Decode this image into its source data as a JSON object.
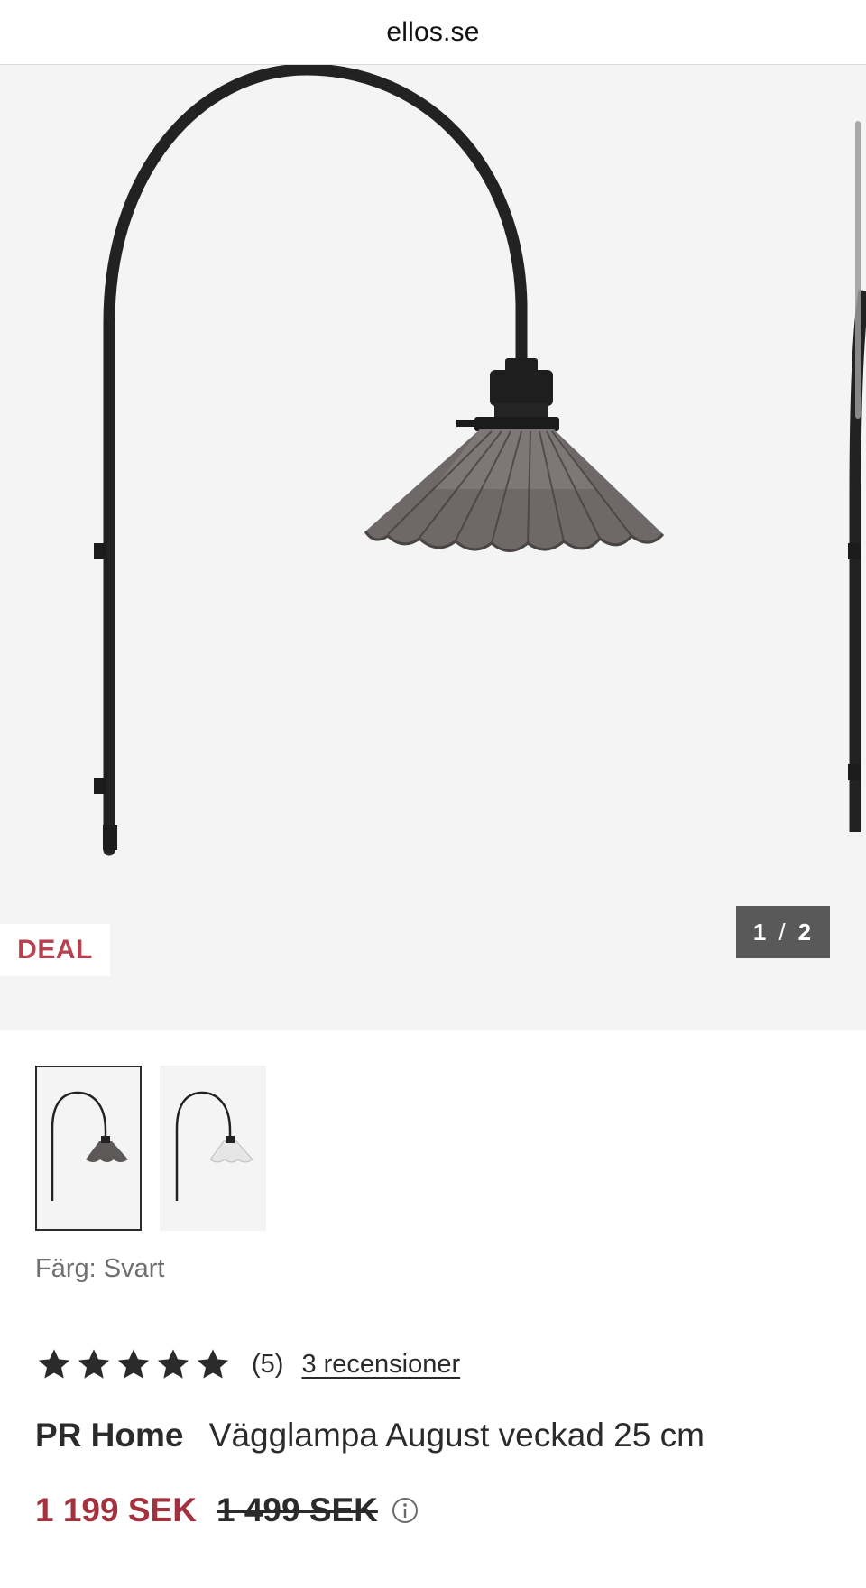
{
  "browser": {
    "domain": "ellos.se"
  },
  "gallery": {
    "badge": "DEAL",
    "counter": {
      "current": "1",
      "separator": "/",
      "total": "2"
    }
  },
  "product": {
    "color_label": "Färg: Svart",
    "rating": {
      "value": 5,
      "max": 5,
      "count_text": "(5)",
      "reviews_link": "3 recensioner"
    },
    "brand": "PR Home",
    "name": "Vägglampa August veckad 25 cm",
    "price_current": "1 199 SEK",
    "price_original": "1 499 SEK"
  },
  "colors": {
    "sale": "#a3323e",
    "deal": "#b64251",
    "text": "#2b2b2b",
    "gallery_bg": "#f4f4f4"
  },
  "icons": [
    "star-icon",
    "info-icon"
  ]
}
